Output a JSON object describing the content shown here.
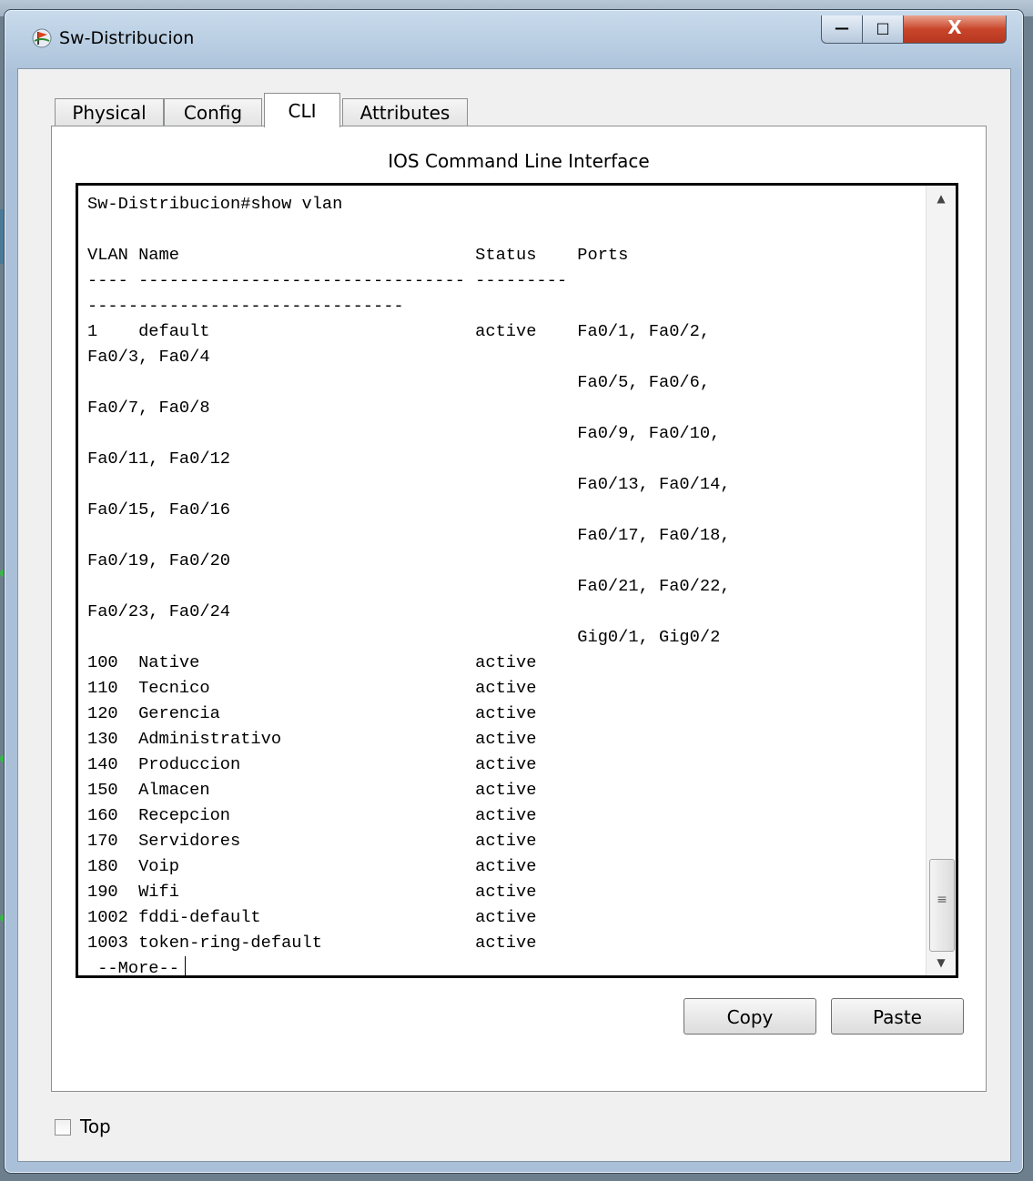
{
  "window": {
    "title": "Sw-Distribucion",
    "minimize_symbol": "—",
    "maximize_symbol": "□",
    "close_symbol": "X"
  },
  "tabs": [
    {
      "label": "Physical",
      "active": false
    },
    {
      "label": "Config",
      "active": false
    },
    {
      "label": "CLI",
      "active": true
    },
    {
      "label": "Attributes",
      "active": false
    }
  ],
  "cli": {
    "panel_title": "IOS Command Line Interface",
    "output": "Sw-Distribucion#show vlan\n\nVLAN Name                             Status    Ports\n---- -------------------------------- ---------\n-------------------------------\n1    default                          active    Fa0/1, Fa0/2,\nFa0/3, Fa0/4\n                                                Fa0/5, Fa0/6,\nFa0/7, Fa0/8\n                                                Fa0/9, Fa0/10,\nFa0/11, Fa0/12\n                                                Fa0/13, Fa0/14,\nFa0/15, Fa0/16\n                                                Fa0/17, Fa0/18,\nFa0/19, Fa0/20\n                                                Fa0/21, Fa0/22,\nFa0/23, Fa0/24\n                                                Gig0/1, Gig0/2\n100  Native                           active\n110  Tecnico                          active\n120  Gerencia                         active\n130  Administrativo                   active\n140  Produccion                       active\n150  Almacen                          active\n160  Recepcion                        active\n170  Servidores                       active\n180  Voip                             active\n190  Wifi                             active\n1002 fddi-default                     active\n1003 token-ring-default               active",
    "more_prompt": " --More--",
    "scroll_up_symbol": "▲",
    "scroll_down_symbol": "▼",
    "scroll_grip_symbol": "≡"
  },
  "buttons": {
    "copy_label": "Copy",
    "paste_label": "Paste"
  },
  "top_checkbox": {
    "label": "Top",
    "checked": false
  },
  "colors": {
    "close_button": "#c9462b",
    "window_frame": "#aac1d9"
  }
}
